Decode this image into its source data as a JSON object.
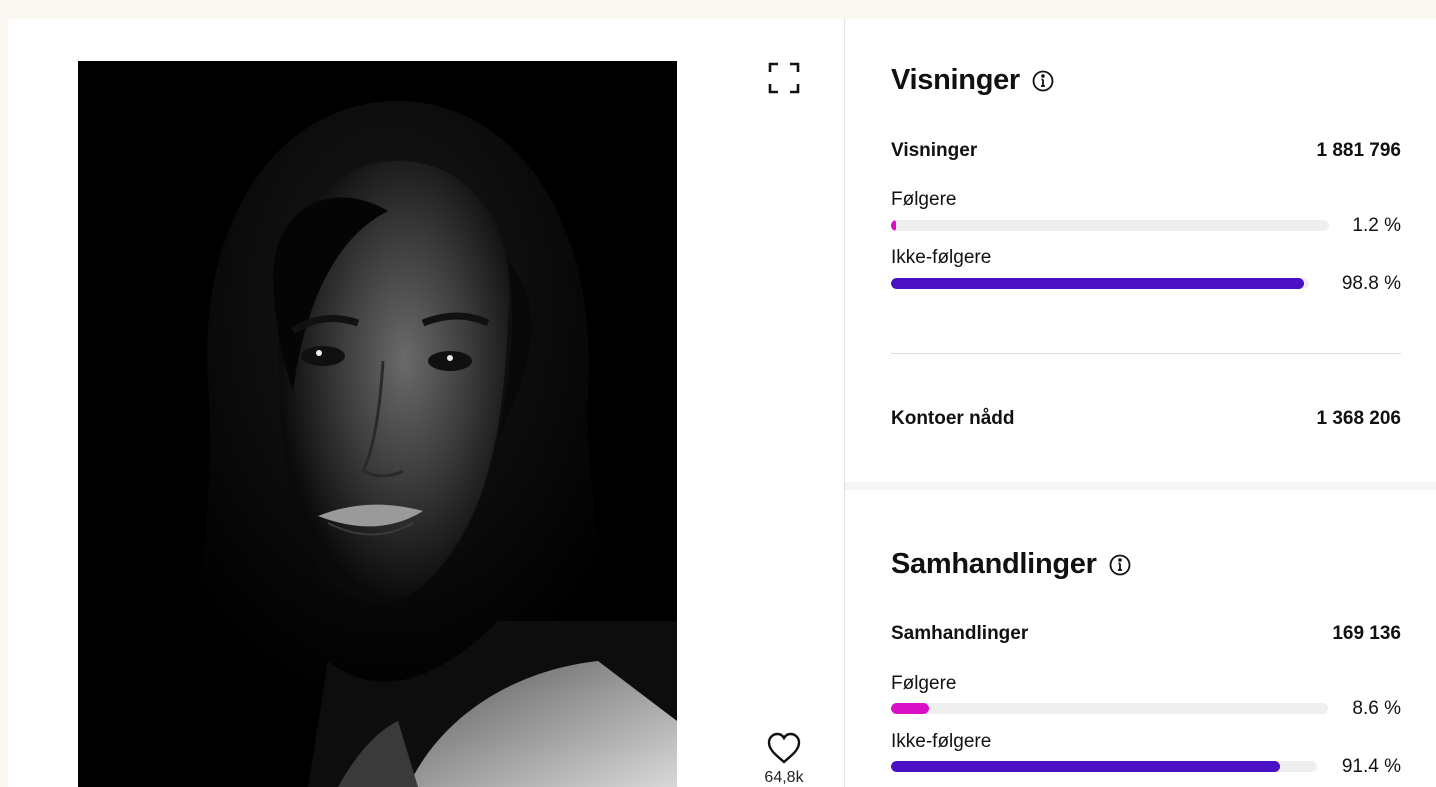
{
  "post": {
    "likes": "64,8k"
  },
  "views": {
    "title": "Visninger",
    "total_label": "Visninger",
    "total_value": "1 881 796",
    "followers_label": "Følgere",
    "followers_pct_text": "1.2 %",
    "followers_fraction": 0.012,
    "nonfollowers_label": "Ikke-følgere",
    "nonfollowers_pct_text": "98.8 %",
    "nonfollowers_fraction": 0.988,
    "reach_label": "Kontoer nådd",
    "reach_value": "1 368 206"
  },
  "interactions": {
    "title": "Samhandlinger",
    "total_label": "Samhandlinger",
    "total_value": "169 136",
    "followers_label": "Følgere",
    "followers_pct_text": "8.6 %",
    "followers_fraction": 0.086,
    "nonfollowers_label": "Ikke-følgere",
    "nonfollowers_pct_text": "91.4 %",
    "nonfollowers_fraction": 0.914
  },
  "colors": {
    "followers": "#d90fc8",
    "nonfollowers": "#4b0fc4",
    "track": "#efefef"
  },
  "icons": {
    "expand": "expand-icon",
    "info": "info-icon",
    "like": "heart-icon"
  }
}
